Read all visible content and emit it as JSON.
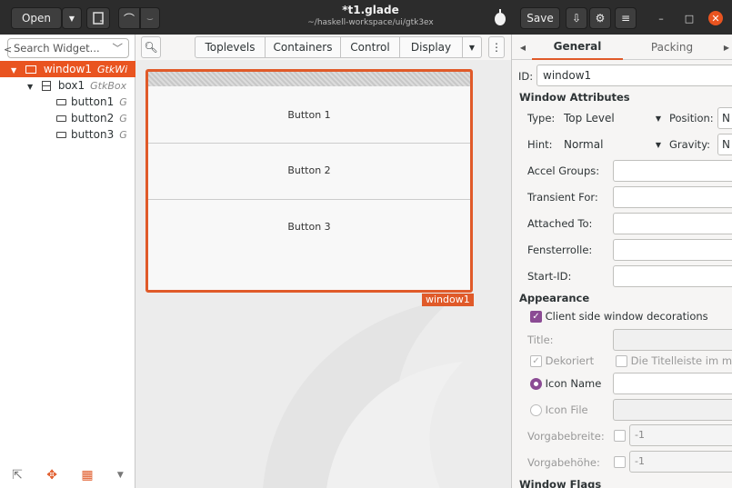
{
  "header": {
    "open_label": "Open",
    "title": "*t1.glade",
    "subtitle": "~/haskell-workspace/ui/gtk3ex",
    "save_label": "Save"
  },
  "left": {
    "search_placeholder": "Search Widget...",
    "tree": [
      {
        "name": "window1",
        "class": "GtkWi"
      },
      {
        "name": "box1",
        "class": "GtkBox"
      },
      {
        "name": "button1",
        "class": "G"
      },
      {
        "name": "button2",
        "class": "G"
      },
      {
        "name": "button3",
        "class": "G"
      }
    ]
  },
  "center": {
    "tabs": [
      "Toplevels",
      "Containers",
      "Control",
      "Display"
    ],
    "buttons": [
      "Button 1",
      "Button 2",
      "Button 3"
    ],
    "window_label": "window1"
  },
  "right": {
    "tabs": [
      "General",
      "Packing"
    ],
    "id_label": "ID:",
    "id_value": "window1",
    "window_attributes": "Window Attributes",
    "type_label": "Type:",
    "type_value": "Top Level",
    "position_label": "Position:",
    "position_value": "N",
    "hint_label": "Hint:",
    "hint_value": "Normal",
    "gravity_label": "Gravity:",
    "gravity_value": "N",
    "fields": [
      "Accel Groups:",
      "Transient For:",
      "Attached To:",
      "Fensterrolle:",
      "Start-ID:"
    ],
    "appearance": "Appearance",
    "client_side": "Client side window decorations",
    "title_label": "Title:",
    "dekoriert": "Dekoriert",
    "titelleiste": "Die Titelleiste im max",
    "icon_name": "Icon Name",
    "icon_file": "Icon File",
    "vbreite": "Vorgabebreite:",
    "vhoehe": "Vorgabehöhe:",
    "default_val": "-1",
    "window_flags": "Window Flags"
  },
  "colors": {
    "accent": "#e05a29",
    "check": "#8b4b94"
  }
}
